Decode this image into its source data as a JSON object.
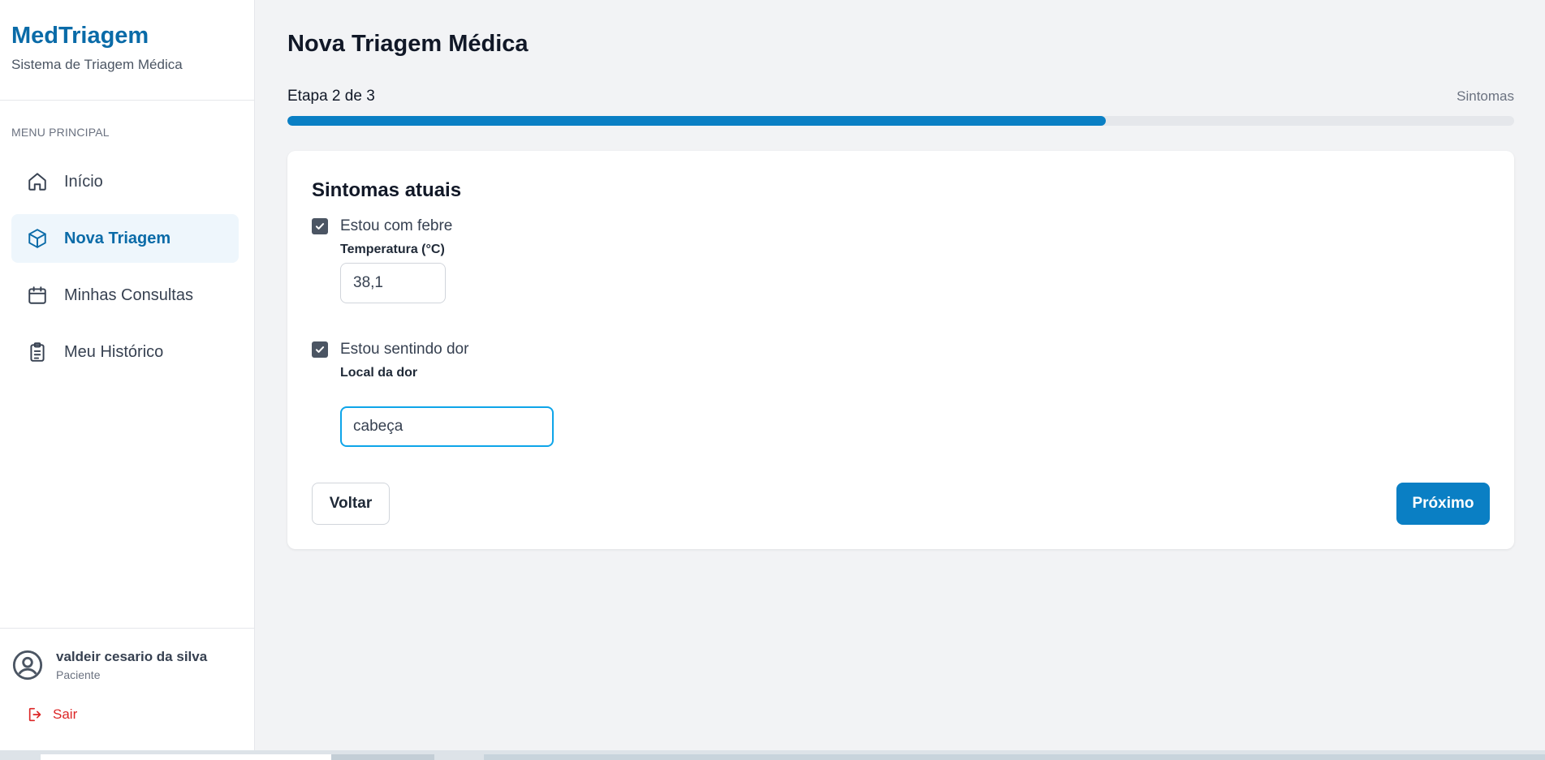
{
  "brand": {
    "title": "MedTriagem",
    "subtitle": "Sistema de Triagem Médica"
  },
  "menu": {
    "label": "MENU PRINCIPAL",
    "items": [
      {
        "label": "Início",
        "icon": "home-icon",
        "active": false
      },
      {
        "label": "Nova Triagem",
        "icon": "cube-icon",
        "active": true
      },
      {
        "label": "Minhas Consultas",
        "icon": "calendar-icon",
        "active": false
      },
      {
        "label": "Meu Histórico",
        "icon": "clipboard-icon",
        "active": false
      }
    ]
  },
  "user": {
    "name": "valdeir cesario da silva",
    "role": "Paciente",
    "logout_label": "Sair"
  },
  "page": {
    "title": "Nova Triagem Médica",
    "step_text": "Etapa 2 de 3",
    "step_name": "Sintomas",
    "progress_fraction": 0.667
  },
  "form": {
    "title": "Sintomas atuais",
    "fever": {
      "label": "Estou com febre",
      "checked": true,
      "field_label": "Temperatura (°C)",
      "value": "38,1"
    },
    "pain": {
      "label": "Estou sentindo dor",
      "checked": true,
      "field_label": "Local da dor",
      "value": "cabeça"
    },
    "back_label": "Voltar",
    "next_label": "Próximo"
  },
  "colors": {
    "brand": "#0a6ba8",
    "primary": "#0a7fc4",
    "danger": "#dc2626",
    "focus": "#0ea5e9"
  }
}
